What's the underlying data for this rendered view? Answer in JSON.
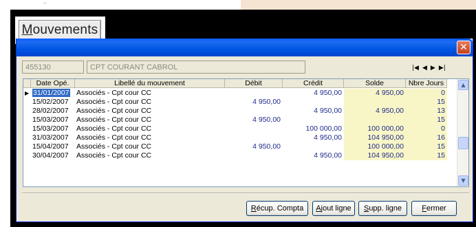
{
  "page_header": {
    "tab_label": "Mouvements"
  },
  "window": {
    "close_symbol": "✕",
    "account_code": "455130",
    "account_name": "CPT COURANT CABROL",
    "nav": {
      "first": "|◀",
      "prev": "◀",
      "next": "▶",
      "last": "▶|"
    }
  },
  "grid": {
    "indicator": "▶",
    "headers": {
      "date": "Date Opé.",
      "libelle": "Libellé du mouvement",
      "debit": "Débit",
      "credit": "Crédit",
      "solde": "Solde",
      "jours": "Nbre Jours"
    },
    "rows": [
      {
        "date": "31/01/2007",
        "libelle": "Associés - Cpt cour CC",
        "debit": "",
        "credit": "4 950,00",
        "solde": "4 950,00",
        "jours": "0"
      },
      {
        "date": "15/02/2007",
        "libelle": "Associés - Cpt cour CC",
        "debit": "4 950,00",
        "credit": "",
        "solde": "",
        "jours": "15"
      },
      {
        "date": "28/02/2007",
        "libelle": "Associés - Cpt cour CC",
        "debit": "",
        "credit": "4 950,00",
        "solde": "4 950,00",
        "jours": "13"
      },
      {
        "date": "15/03/2007",
        "libelle": "Associés - Cpt cour CC",
        "debit": "4 950,00",
        "credit": "",
        "solde": "",
        "jours": "15"
      },
      {
        "date": "15/03/2007",
        "libelle": "Associés - Cpt cour CC",
        "debit": "",
        "credit": "100 000,00",
        "solde": "100 000,00",
        "jours": "0"
      },
      {
        "date": "31/03/2007",
        "libelle": "Associés - Cpt cour CC",
        "debit": "",
        "credit": "4 950,00",
        "solde": "104 950,00",
        "jours": "16"
      },
      {
        "date": "15/04/2007",
        "libelle": "Associés - Cpt cour CC",
        "debit": "4 950,00",
        "credit": "",
        "solde": "100 000,00",
        "jours": "15"
      },
      {
        "date": "30/04/2007",
        "libelle": "Associés - Cpt cour CC",
        "debit": "",
        "credit": "4 950,00",
        "solde": "104 950,00",
        "jours": "15"
      }
    ]
  },
  "buttons": {
    "recup": "Récup. Compta",
    "ajout": "Ajout ligne",
    "supp": "Supp. ligne",
    "fermer": "Fermer"
  },
  "colors": {
    "titlebar": "#0055e5",
    "selection": "#316ac5",
    "solde_bg": "#f8f6c6",
    "amount_text": "#1f2a8a"
  },
  "icons": {
    "close": "close-icon",
    "scroll_up": "chevron-up-icon",
    "scroll_down": "chevron-down-icon",
    "row_indicator": "row-pointer-icon"
  }
}
